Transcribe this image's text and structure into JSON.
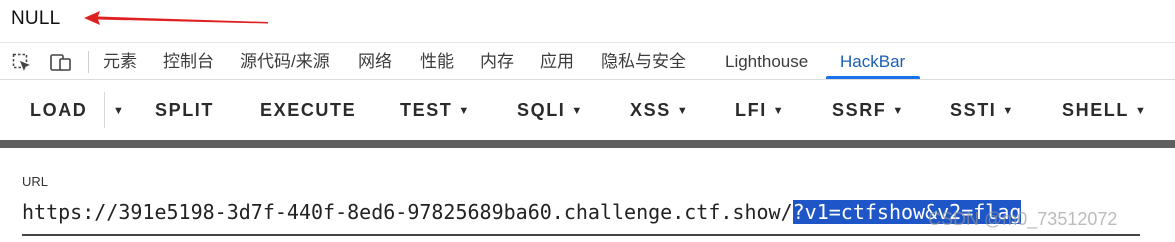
{
  "page_output": {
    "text": "NULL"
  },
  "devtools": {
    "tabs": [
      {
        "label": "元素"
      },
      {
        "label": "控制台"
      },
      {
        "label": "源代码/来源"
      },
      {
        "label": "网络"
      },
      {
        "label": "性能"
      },
      {
        "label": "内存"
      },
      {
        "label": "应用"
      },
      {
        "label": "隐私与安全"
      },
      {
        "label": "Lighthouse"
      },
      {
        "label": "HackBar"
      }
    ],
    "active_tab": "HackBar",
    "accent_color": "#1a73e8"
  },
  "hackbar": {
    "buttons": {
      "load": "LOAD",
      "split": "SPLIT",
      "execute": "EXECUTE",
      "test": "TEST",
      "sqli": "SQLI",
      "xss": "XSS",
      "lfi": "LFI",
      "ssrf": "SSRF",
      "ssti": "SSTI",
      "shell": "SHELL"
    },
    "caret": "▼",
    "url_label": "URL",
    "url_base": "https://391e5198-3d7f-440f-8ed6-97825689ba60.challenge.ctf.show/",
    "url_query": "?v1=ctfshow&v2=flag",
    "highlight_color": "#1e56c8"
  },
  "watermark": "CSDN @m0_73512072"
}
